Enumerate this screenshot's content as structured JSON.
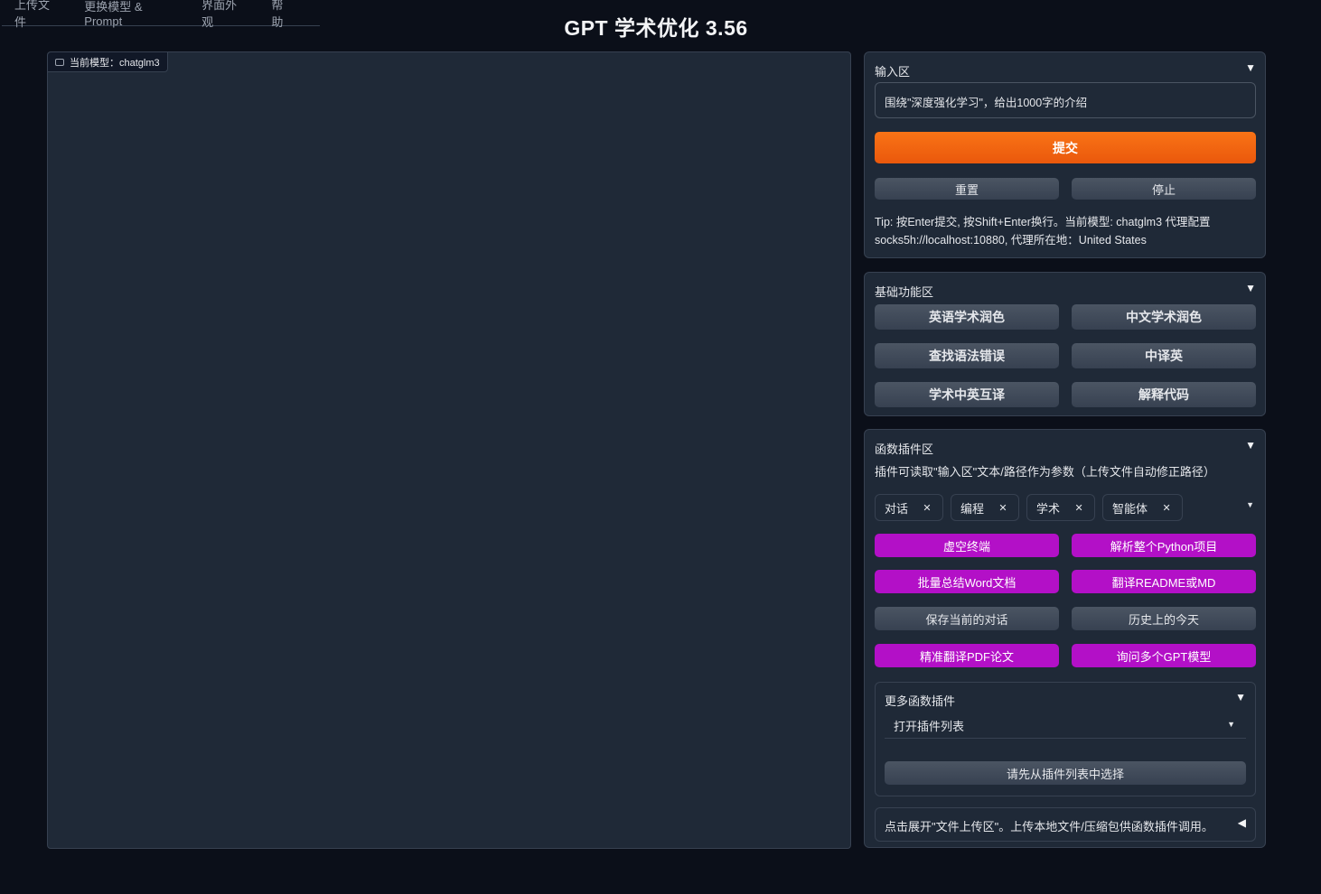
{
  "menu": [
    "上传文件",
    "更换模型 & Prompt",
    "界面外观",
    "帮助"
  ],
  "title": "GPT 学术优化 3.56",
  "chat": {
    "model_label": "当前模型：chatglm3"
  },
  "input_panel": {
    "header": "输入区",
    "input_value": "围绕\"深度强化学习\"，给出1000字的介绍",
    "submit": "提交",
    "reset": "重置",
    "stop": "停止",
    "tip": "Tip: 按Enter提交, 按Shift+Enter换行。当前模型: chatglm3 代理配置 socks5h://localhost:10880, 代理所在地：United States"
  },
  "basic_panel": {
    "header": "基础功能区",
    "buttons": [
      "英语学术润色",
      "中文学术润色",
      "查找语法错误",
      "中译英",
      "学术中英互译",
      "解释代码"
    ]
  },
  "plugin_panel": {
    "header": "函数插件区",
    "desc": "插件可读取\"输入区\"文本/路径作为参数（上传文件自动修正路径）",
    "tags": [
      "对话",
      "编程",
      "学术",
      "智能体"
    ],
    "buttons": [
      "虚空终端",
      "解析整个Python项目",
      "批量总结Word文档",
      "翻译README或MD",
      "保存当前的对话",
      "历史上的今天",
      "精准翻译PDF论文",
      "询问多个GPT模型"
    ],
    "more": {
      "header": "更多函数插件",
      "select": "打开插件列表",
      "run": "请先从插件列表中选择"
    },
    "upload": "点击展开\"文件上传区\"。上传本地文件/压缩包供函数插件调用。"
  },
  "colors": {
    "background": "#0b0f19",
    "panel": "#1f2937",
    "primary": "#ea580c",
    "purple": "#b310c7"
  }
}
